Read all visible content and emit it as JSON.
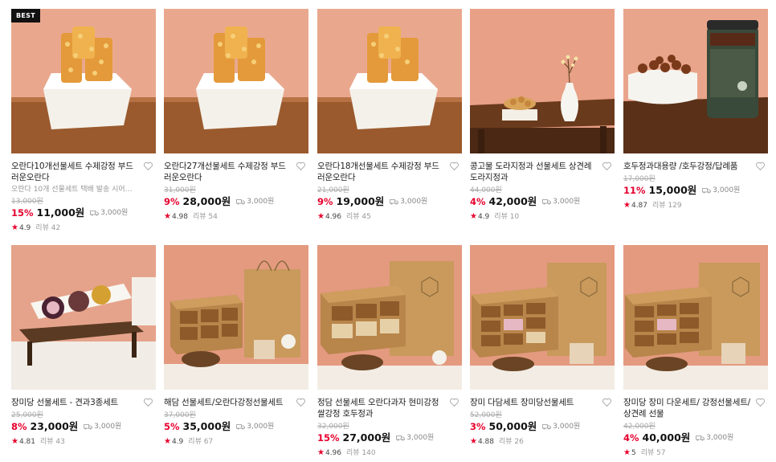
{
  "badge_best": "BEST",
  "products": [
    {
      "name": "오란다10개선물세트 수제강정 부드러운오란다",
      "desc": "오란다 10개 선물세트 택배 발송 시어…",
      "orig_price": "13,000원",
      "discount": "15%",
      "price": "11,000원",
      "shipping": "3,000원",
      "score": "4.9",
      "reviews": "리뷰 42",
      "badge": true,
      "image": "oranda-on-white-octagon-dish"
    },
    {
      "name": "오란다27개선물세트 수제강정 부드러운오란다",
      "orig_price": "31,000원",
      "discount": "9%",
      "price": "28,000원",
      "shipping": "3,000원",
      "score": "4.98",
      "reviews": "리뷰 54",
      "image": "oranda-on-white-octagon-dish"
    },
    {
      "name": "오란다18개선물세트 수제강정 부드러운오란다",
      "orig_price": "21,000원",
      "discount": "9%",
      "price": "19,000원",
      "shipping": "3,000원",
      "score": "4.96",
      "reviews": "리뷰 45",
      "image": "oranda-on-white-octagon-dish"
    },
    {
      "name": "콩고물 도라지정과 선물세트 상견례 도라지정과",
      "orig_price": "44,000원",
      "discount": "4%",
      "price": "42,000원",
      "shipping": "3,000원",
      "score": "4.9",
      "reviews": "리뷰 10",
      "image": "small-dish-and-vase-on-table"
    },
    {
      "name": "호두정과대용량 /호두강정/답례품",
      "orig_price": "17,000원",
      "discount": "11%",
      "price": "15,000원",
      "shipping": "3,000원",
      "score": "4.87",
      "reviews": "리뷰 129",
      "image": "walnut-jar-and-dish"
    },
    {
      "name": "장미당 선물세트 - 견과3종세트",
      "orig_price": "25,000원",
      "discount": "8%",
      "price": "23,000원",
      "shipping": "3,000원",
      "score": "4.81",
      "reviews": "리뷰 43",
      "image": "three-round-snacks-box"
    },
    {
      "name": "해담 선물세트/오란다강정선물세트",
      "orig_price": "37,000원",
      "discount": "5%",
      "price": "35,000원",
      "shipping": "3,000원",
      "score": "4.9",
      "reviews": "리뷰 67",
      "image": "kraft-gift-box-six"
    },
    {
      "name": "정담 선물세트 오란다과자 현미강정 쌀강정 호두정과",
      "orig_price": "32,000원",
      "discount": "15%",
      "price": "27,000원",
      "shipping": "3,000원",
      "score": "4.96",
      "reviews": "리뷰 140",
      "image": "kraft-gift-box-six"
    },
    {
      "name": "장미 다담세트 장미당선물세트",
      "orig_price": "52,000원",
      "discount": "3%",
      "price": "50,000원",
      "shipping": "3,000원",
      "score": "4.88",
      "reviews": "리뷰 26",
      "image": "kraft-gift-box-nine"
    },
    {
      "name": "장미당 장미 다운세트/ 강정선물세트/상견례 선물",
      "orig_price": "42,000원",
      "discount": "4%",
      "price": "40,000원",
      "shipping": "3,000원",
      "score": "5",
      "reviews": "리뷰 57",
      "image": "kraft-gift-box-nine"
    }
  ],
  "colors": {
    "discount": "#e6002d",
    "star": "#e6002d",
    "background_peach": "#e8a48a"
  }
}
